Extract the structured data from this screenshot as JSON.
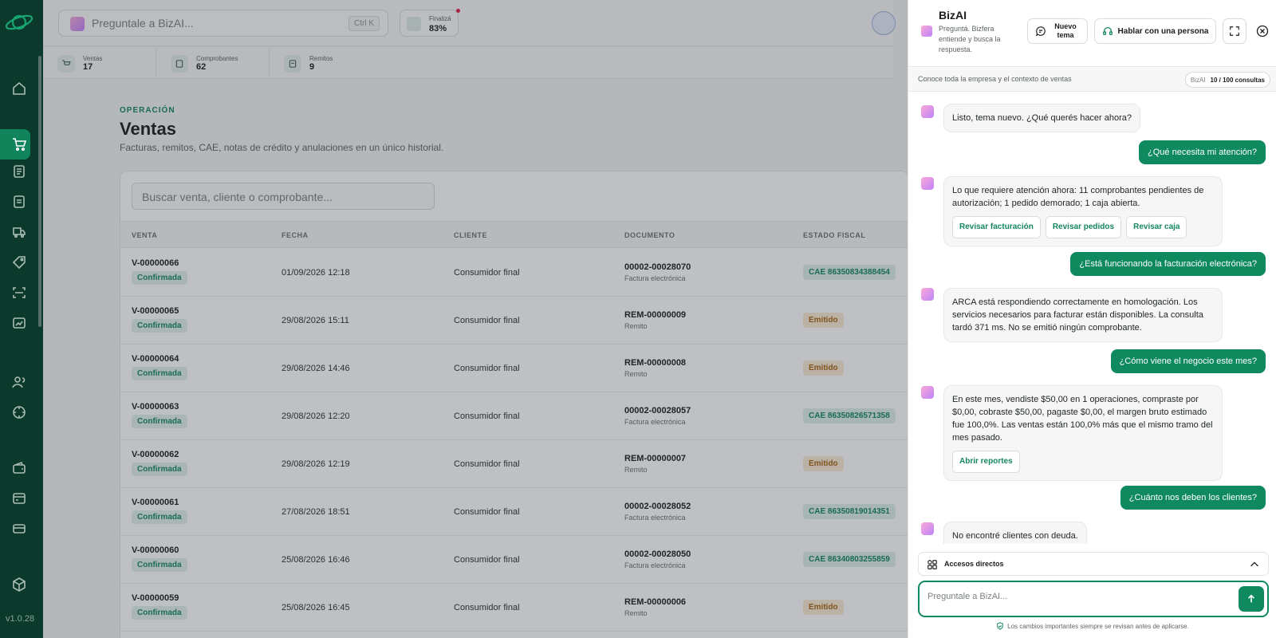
{
  "rail": {
    "version": "v1.0.28"
  },
  "topbar": {
    "ask_placeholder": "Preguntale a BizAI...",
    "shortcut": "Ctrl K",
    "progress_label": "Finalizá",
    "progress_value": "83%"
  },
  "stats": [
    {
      "label": "Ventas",
      "value": "17"
    },
    {
      "label": "Comprobantes",
      "value": "62"
    },
    {
      "label": "Remitos",
      "value": "9"
    }
  ],
  "page": {
    "kicker": "OPERACIÓN",
    "title": "Ventas",
    "subtitle": "Facturas, remitos, CAE, notas de crédito y anulaciones en un único historial.",
    "search_placeholder": "Buscar venta, cliente o comprobante..."
  },
  "table": {
    "headers": [
      "VENTA",
      "FECHA",
      "CLIENTE",
      "DOCUMENTO",
      "ESTADO FISCAL"
    ],
    "rows": [
      {
        "id": "V-00000066",
        "status": "Confirmada",
        "date": "01/09/2026 12:18",
        "client": "Consumidor final",
        "doc": "00002-00028070",
        "doctype": "Factura electrónica",
        "fiscal": "CAE 86350834388454",
        "fiscal_kind": "cae"
      },
      {
        "id": "V-00000065",
        "status": "Confirmada",
        "date": "29/08/2026 15:11",
        "client": "Consumidor final",
        "doc": "REM-00000009",
        "doctype": "Remito",
        "fiscal": "Emitido",
        "fiscal_kind": "emit"
      },
      {
        "id": "V-00000064",
        "status": "Confirmada",
        "date": "29/08/2026 14:46",
        "client": "Consumidor final",
        "doc": "REM-00000008",
        "doctype": "Remito",
        "fiscal": "Emitido",
        "fiscal_kind": "emit"
      },
      {
        "id": "V-00000063",
        "status": "Confirmada",
        "date": "29/08/2026 12:20",
        "client": "Consumidor final",
        "doc": "00002-00028057",
        "doctype": "Factura electrónica",
        "fiscal": "CAE 86350826571358",
        "fiscal_kind": "cae"
      },
      {
        "id": "V-00000062",
        "status": "Confirmada",
        "date": "29/08/2026 12:19",
        "client": "Consumidor final",
        "doc": "REM-00000007",
        "doctype": "Remito",
        "fiscal": "Emitido",
        "fiscal_kind": "emit"
      },
      {
        "id": "V-00000061",
        "status": "Confirmada",
        "date": "27/08/2026 18:51",
        "client": "Consumidor final",
        "doc": "00002-00028052",
        "doctype": "Factura electrónica",
        "fiscal": "CAE 86350819014351",
        "fiscal_kind": "cae"
      },
      {
        "id": "V-00000060",
        "status": "Confirmada",
        "date": "25/08/2026 16:46",
        "client": "Consumidor final",
        "doc": "00002-00028050",
        "doctype": "Factura electrónica",
        "fiscal": "CAE 86340803255859",
        "fiscal_kind": "cae"
      },
      {
        "id": "V-00000059",
        "status": "Confirmada",
        "date": "25/08/2026 16:45",
        "client": "Consumidor final",
        "doc": "REM-00000006",
        "doctype": "Remito",
        "fiscal": "Emitido",
        "fiscal_kind": "emit"
      }
    ]
  },
  "chat": {
    "title": "BizAI",
    "tagline": "Preguntá. Bizfera entiende y busca la respuesta.",
    "new_topic": "Nuevo tema",
    "talk_human": "Hablar con una persona",
    "context": "Conoce toda la empresa y el contexto de ventas",
    "quota_label": "BizAI",
    "quota_value": "10 / 100 consultas",
    "messages": [
      {
        "role": "bot",
        "text": "Listo, tema nuevo. ¿Qué querés hacer ahora?"
      },
      {
        "role": "user",
        "text": "¿Qué necesita mi atención?"
      },
      {
        "role": "bot",
        "text": "Lo que requiere atención ahora: 11 comprobantes pendientes de autorización; 1 pedido demorado; 1 caja abierta.",
        "actions": [
          "Revisar facturación",
          "Revisar pedidos",
          "Revisar caja"
        ]
      },
      {
        "role": "user",
        "text": "¿Está funcionando la facturación electrónica?"
      },
      {
        "role": "bot",
        "text": "ARCA está respondiendo correctamente en homologación. Los servicios necesarios para facturar están disponibles. La consulta tardó 371 ms. No se emitió ningún comprobante."
      },
      {
        "role": "user",
        "text": "¿Cómo viene el negocio este mes?"
      },
      {
        "role": "bot",
        "text": "En este mes, vendiste $50,00 en 1 operaciones, compraste por $0,00, cobraste $50,00, pagaste $0,00, el margen bruto estimado fue 100,0%. Las ventas están 100,0% más que el mismo tramo del mes pasado.",
        "actions": [
          "Abrir reportes"
        ]
      },
      {
        "role": "user",
        "text": "¿Cuánto nos deben los clientes?"
      },
      {
        "role": "bot",
        "text": "No encontré clientes con deuda."
      }
    ],
    "quick_access": "Accesos directos",
    "input_placeholder": "Preguntale a BizAI...",
    "footnote": "Los cambios importantes siempre se revisan antes de aplicarse."
  }
}
